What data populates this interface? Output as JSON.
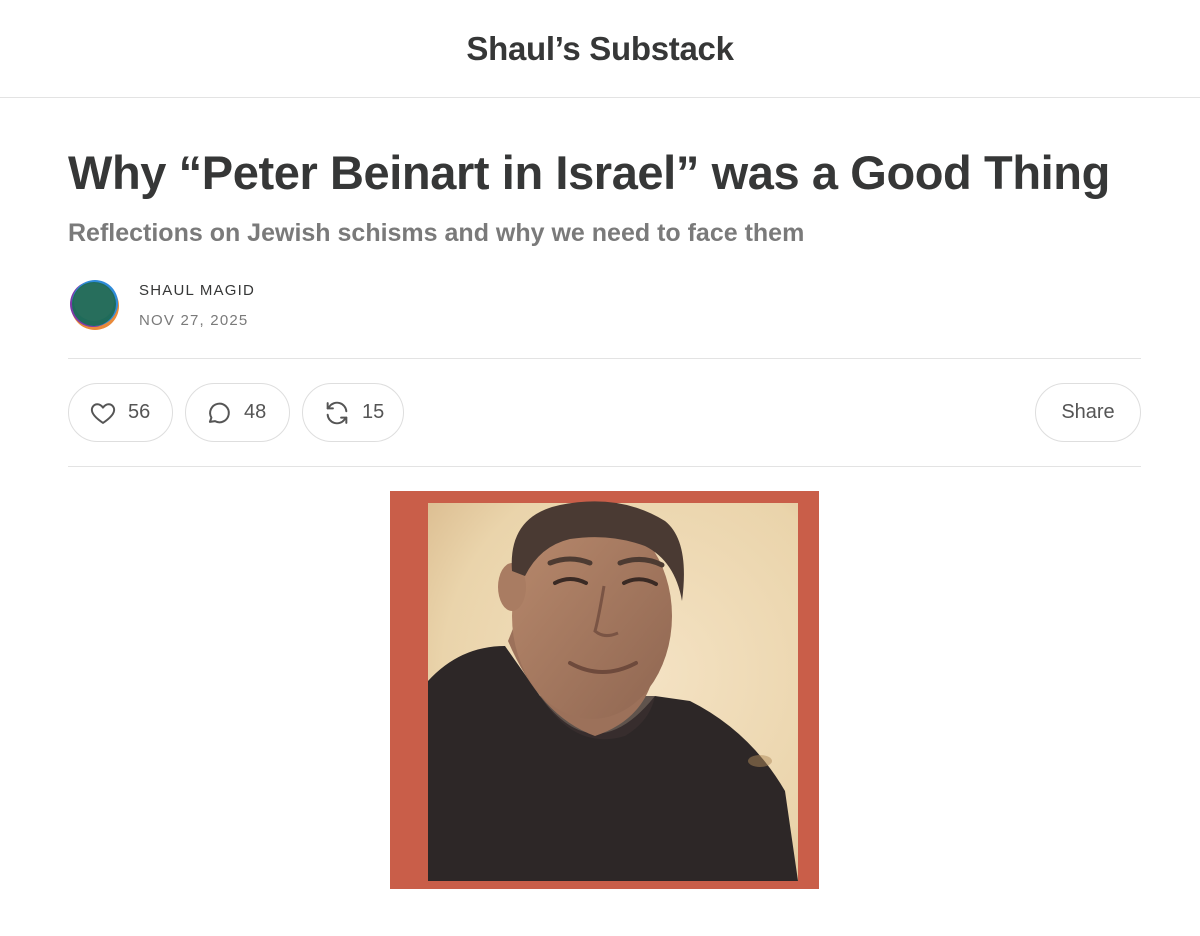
{
  "publication": {
    "name": "Shaul’s Substack"
  },
  "post": {
    "title": "Why “Peter Beinart in Israel” was a Good Thing",
    "subtitle": "Reflections on Jewish schisms and why we need to face them",
    "author": "SHAUL MAGID",
    "date": "NOV 27, 2025"
  },
  "actions": {
    "likes": "56",
    "comments": "48",
    "restacks": "15",
    "share_label": "Share"
  },
  "icons": {
    "like": "heart-icon",
    "comment": "speech-bubble-icon",
    "restack": "restack-arrows-icon"
  },
  "colors": {
    "text": "#363737",
    "muted": "#7a7a7a",
    "border": "#dedede",
    "photo_frame": "#c95e49"
  }
}
